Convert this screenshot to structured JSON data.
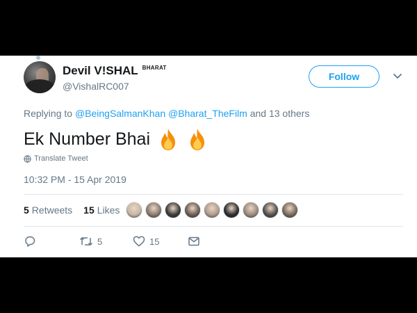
{
  "user": {
    "display_name": "Devil V!SHAL",
    "name_tag": "BHARAT",
    "handle": "@VishalRC007"
  },
  "follow_label": "Follow",
  "reply": {
    "prefix": "Replying to",
    "mention1": "@BeingSalmanKhan",
    "mention2": "@Bharat_TheFilm",
    "suffix": "and 13 others"
  },
  "tweet_text": "Ek Number Bhai",
  "tweet_emoji": [
    "fire-emoji",
    "fire-emoji"
  ],
  "translate_label": "Translate Tweet",
  "timestamp": "10:32 PM - 15 Apr 2019",
  "stats": {
    "retweets_count": "5",
    "retweets_label": "Retweets",
    "likes_count": "15",
    "likes_label": "Likes"
  },
  "liker_avatar_colors": [
    "#c9b7a6",
    "#8c7a6e",
    "#3b3b3b",
    "#6d5d55",
    "#b09c8c",
    "#2e2e2e",
    "#9e8b7d",
    "#55504c",
    "#7a6a5c"
  ],
  "actions": {
    "retweet_count": "5",
    "like_count": "15"
  },
  "colors": {
    "accent": "#1da1f2",
    "secondary_text": "#657786",
    "primary_text": "#14171a"
  }
}
